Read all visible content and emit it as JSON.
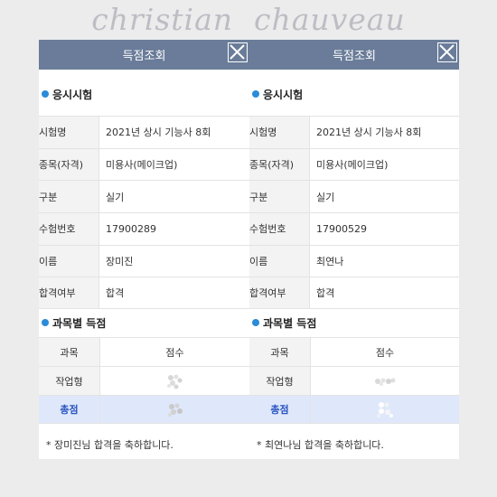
{
  "watermark": "christian  chauveau",
  "panels": [
    {
      "title": "득점조회",
      "section_exam": "응시시험",
      "rows": [
        {
          "label": "시험명",
          "value": "2021년 상시 기능사 8회"
        },
        {
          "label": "종목(자격)",
          "value": "미용사(메이크업)"
        },
        {
          "label": "구분",
          "value": "실기"
        },
        {
          "label": "수험번호",
          "value": "17900289"
        },
        {
          "label": "이름",
          "value": "장미진"
        },
        {
          "label": "합격여부",
          "value": "합격"
        }
      ],
      "section_score": "과목별 득점",
      "score_header": {
        "subject": "과목",
        "score": "점수"
      },
      "score_subject": "작업형",
      "total_label": "총점",
      "message": "* 장미진님 합격을 축하합니다."
    },
    {
      "title": "득점조회",
      "section_exam": "응시시험",
      "rows": [
        {
          "label": "시험명",
          "value": "2021년 상시 기능사 8회"
        },
        {
          "label": "종목(자격)",
          "value": "미용사(메이크업)"
        },
        {
          "label": "구분",
          "value": "실기"
        },
        {
          "label": "수험번호",
          "value": "17900529"
        },
        {
          "label": "이름",
          "value": "최연나"
        },
        {
          "label": "합격여부",
          "value": "합격"
        }
      ],
      "section_score": "과목별 득점",
      "score_header": {
        "subject": "과목",
        "score": "점수"
      },
      "score_subject": "작업형",
      "total_label": "총점",
      "message": "* 최연나님 합격을 축하합니다."
    }
  ],
  "colors": {
    "header": "#6a7c99",
    "bullet": "#2a8bd9",
    "total_row": "#dfe8fb",
    "total_text": "#2b55c0"
  },
  "icons": {
    "close": "close-icon",
    "bullet": "bullet-icon",
    "blurred_score": "blurred-score-icon"
  }
}
